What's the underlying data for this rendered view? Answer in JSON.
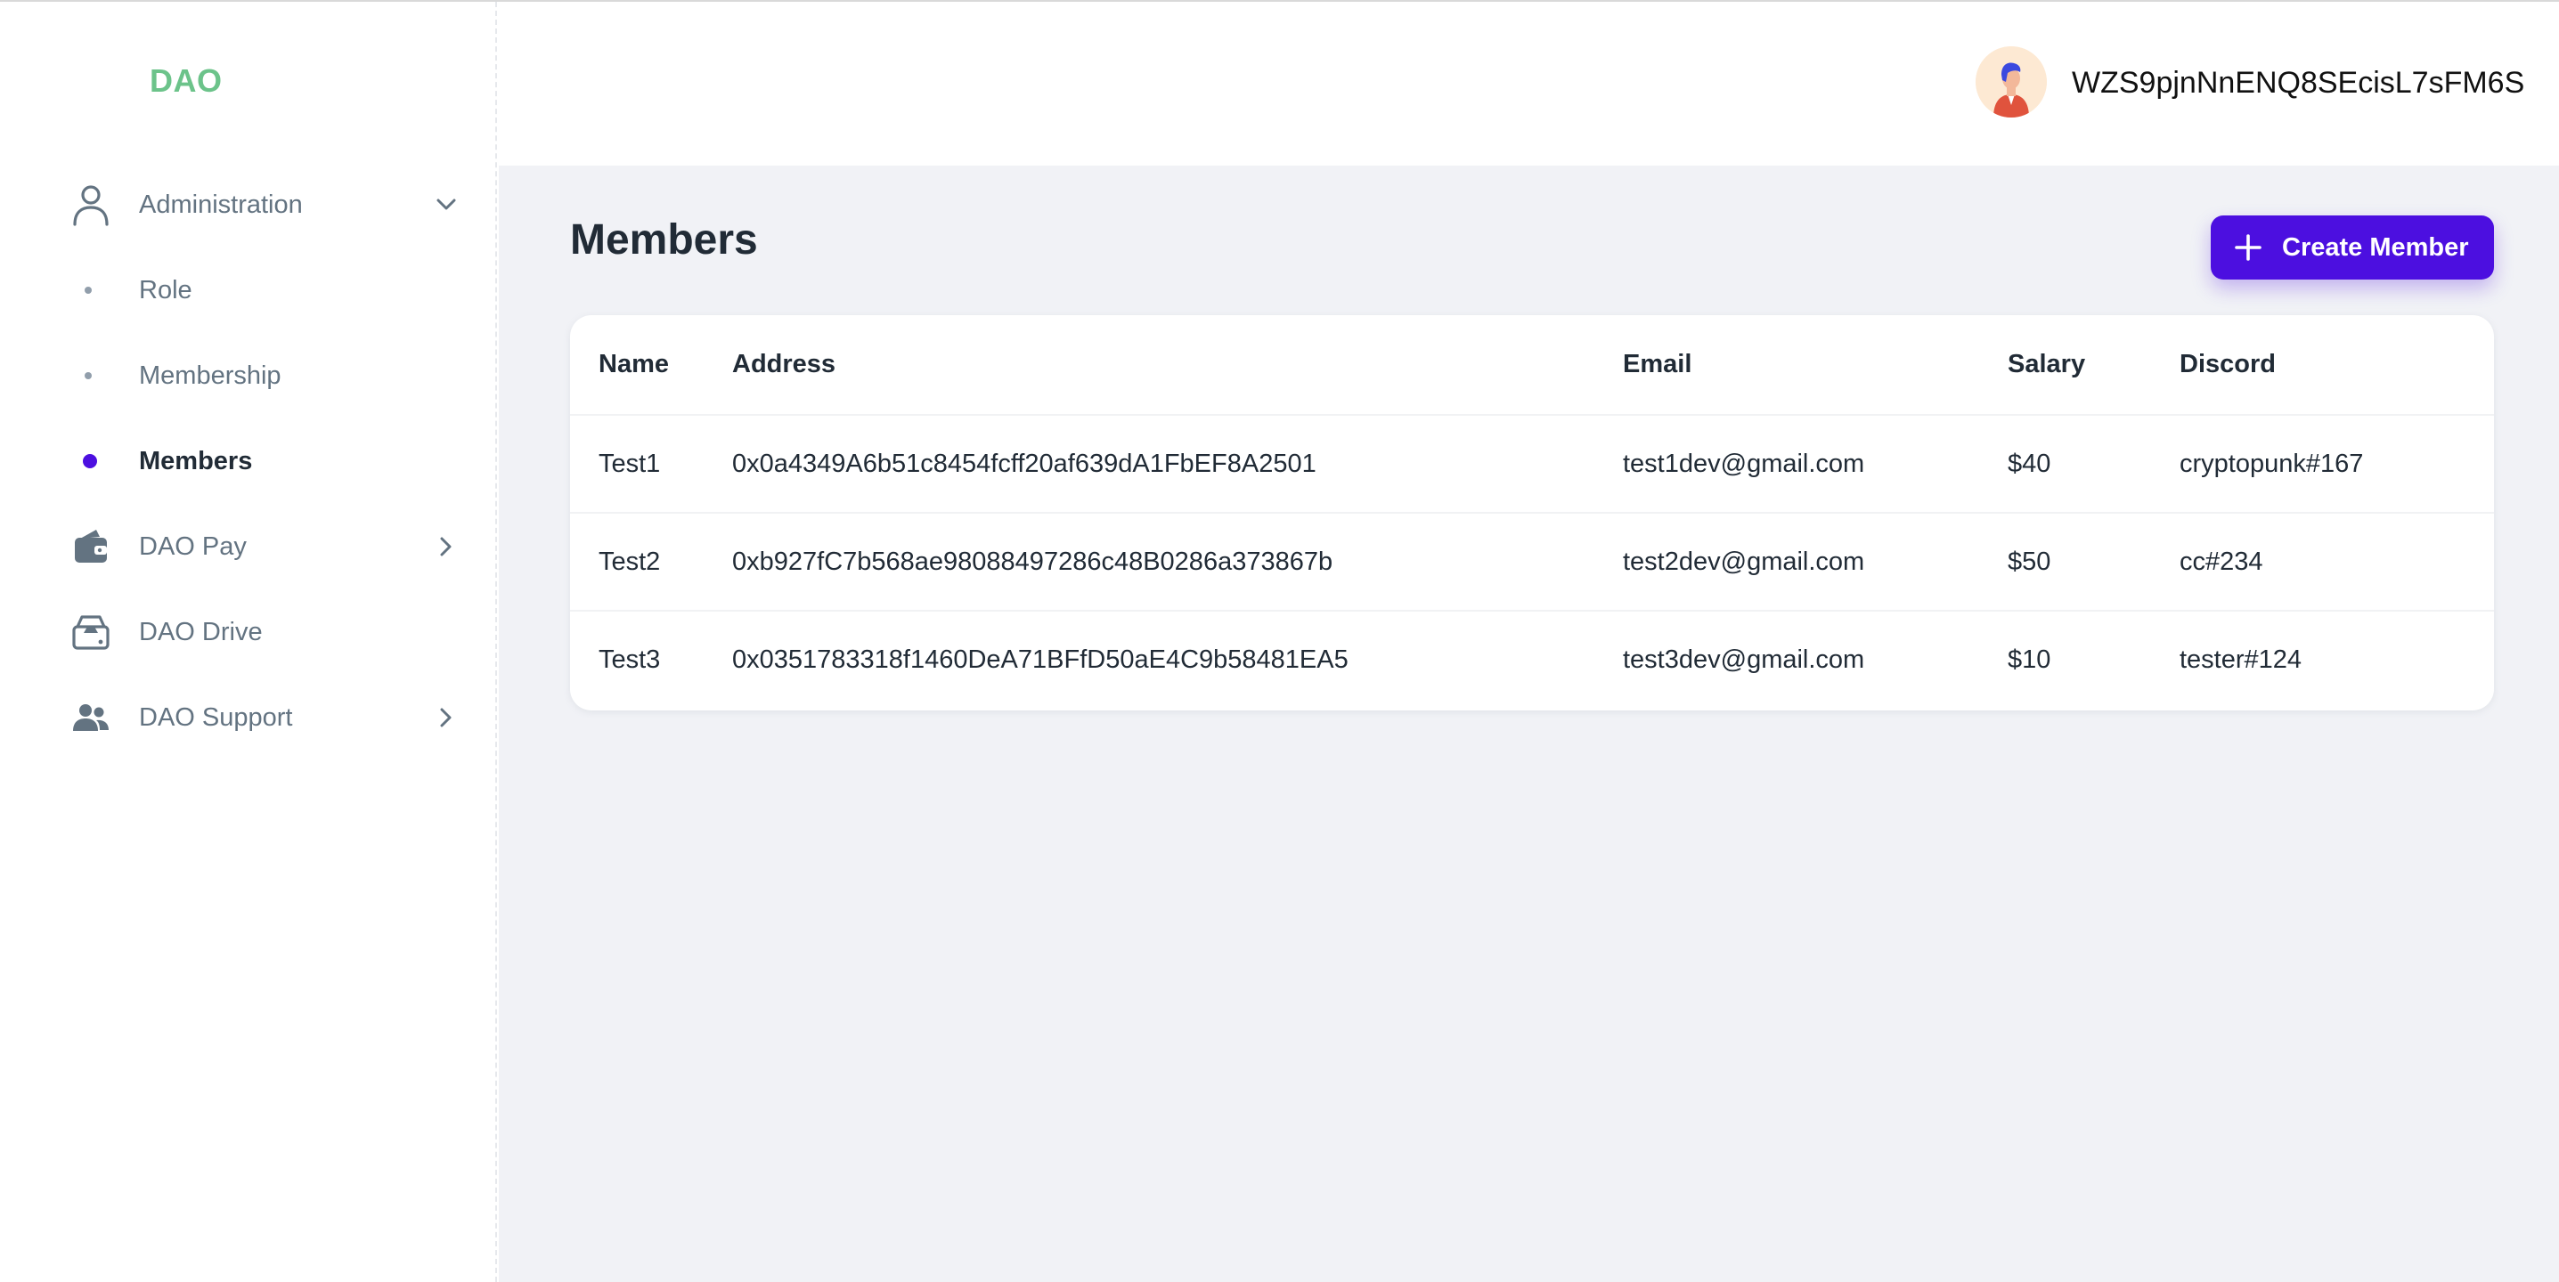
{
  "sidebar": {
    "logo": "DAO",
    "administration": {
      "label": "Administration",
      "icon": "user-outline-icon"
    },
    "sub_items": [
      {
        "label": "Role",
        "active": false
      },
      {
        "label": "Membership",
        "active": false
      },
      {
        "label": "Members",
        "active": true
      }
    ],
    "dao_pay": {
      "label": "DAO Pay",
      "icon": "wallet-icon"
    },
    "dao_drive": {
      "label": "DAO Drive",
      "icon": "drive-icon"
    },
    "dao_support": {
      "label": "DAO Support",
      "icon": "users-icon"
    }
  },
  "header": {
    "username": "WZS9pjnNnENQ8SEcisL7sFM6S"
  },
  "main": {
    "title": "Members",
    "create_button": "Create Member",
    "table": {
      "columns": [
        "Name",
        "Address",
        "Email",
        "Salary",
        "Discord"
      ],
      "rows": [
        [
          "Test1",
          "0x0a4349A6b51c8454fcff20af639dA1FbEF8A2501",
          "test1dev@gmail.com",
          "$40",
          "cryptopunk#167"
        ],
        [
          "Test2",
          "0xb927fC7b568ae98088497286c48B0286a373867b",
          "test2dev@gmail.com",
          "$50",
          "cc#234"
        ],
        [
          "Test3",
          "0x0351783318f1460DeA71BFfD50aE4C9b58481EA5",
          "test3dev@gmail.com",
          "$10",
          "tester#124"
        ]
      ]
    }
  },
  "colors": {
    "accent": "#4c0fe0",
    "logo": "#6cc38a",
    "main_bg": "#f1f2f6",
    "muted_text": "#637381"
  }
}
